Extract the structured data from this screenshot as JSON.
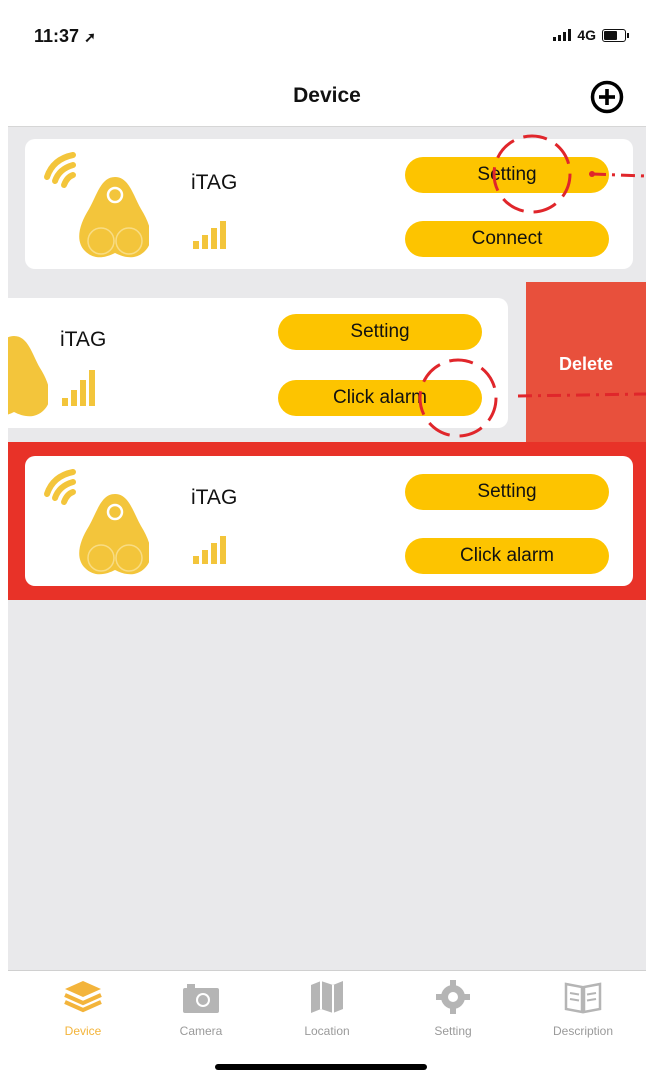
{
  "status": {
    "time": "11:37",
    "network": "4G"
  },
  "nav": {
    "title": "Device"
  },
  "devices": [
    {
      "name": "iTAG",
      "button_top": "Setting",
      "button_bottom": "Connect"
    },
    {
      "name": "iTAG",
      "button_top": "Setting",
      "button_bottom": "Click alarm",
      "swipe_action": "Delete"
    },
    {
      "name": "iTAG",
      "button_top": "Setting",
      "button_bottom": "Click alarm"
    }
  ],
  "tabs": [
    {
      "label": "Device",
      "icon": "layers-icon",
      "active": true
    },
    {
      "label": "Camera",
      "icon": "camera-icon",
      "active": false
    },
    {
      "label": "Location",
      "icon": "map-icon",
      "active": false
    },
    {
      "label": "Setting",
      "icon": "gear-icon",
      "active": false
    },
    {
      "label": "Description",
      "icon": "book-icon",
      "active": false
    }
  ],
  "colors": {
    "accent": "#fdc400",
    "tag": "#f3c53b",
    "delete": "#e8503c",
    "highlight": "#e83228",
    "annotation": "#e0262b"
  }
}
